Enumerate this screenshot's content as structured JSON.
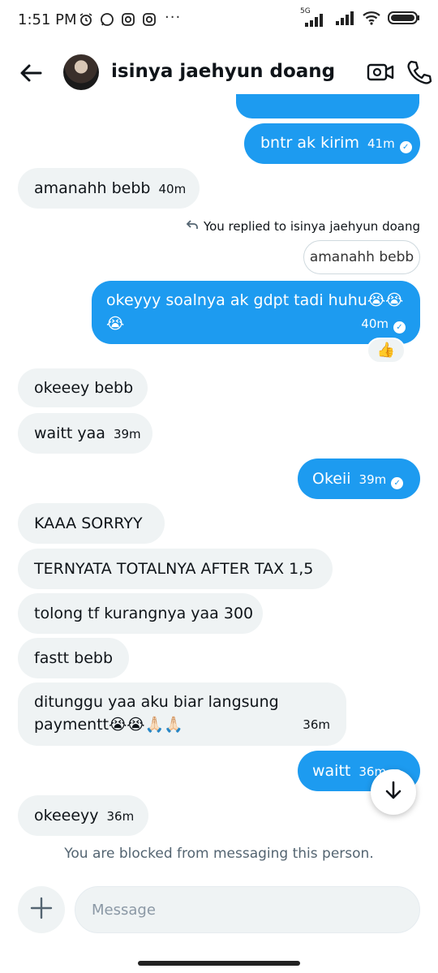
{
  "status_bar": {
    "time": "1:51 PM",
    "left_icons": [
      "alarm-icon",
      "whatsapp-icon",
      "instagram-icon",
      "instagram-icon"
    ],
    "more": "···",
    "network": "5G"
  },
  "header": {
    "title": "isinya jaehyun doang"
  },
  "messages": [
    {
      "dir": "out",
      "text": "bntr ak kirim",
      "time": "41m"
    },
    {
      "dir": "in",
      "text": "amanahh bebb",
      "time": "40m"
    },
    {
      "reply_note": "You replied to isinya jaehyun doang",
      "quoted": "amanahh bebb"
    },
    {
      "dir": "out",
      "text": "okeyyy soalnya ak gdpt tadi huhu😭😭",
      "text2": "😭",
      "time": "40m",
      "reaction": "👍"
    },
    {
      "dir": "in",
      "text": "okeeey bebb"
    },
    {
      "dir": "in",
      "text": "waitt yaa",
      "time": "39m"
    },
    {
      "dir": "out",
      "text": "Okeii",
      "time": "39m"
    },
    {
      "dir": "in",
      "text": "KAAA SORRYY"
    },
    {
      "dir": "in",
      "text": "TERNYATA TOTALNYA AFTER TAX 1,5"
    },
    {
      "dir": "in",
      "text": "tolong tf kurangnya yaa 300"
    },
    {
      "dir": "in",
      "text": "fastt bebb"
    },
    {
      "dir": "in",
      "text": "ditunggu yaa aku biar langsung",
      "text2": "paymentt😭😭🙏🏻🙏🏻",
      "time": "36m"
    },
    {
      "dir": "out",
      "text": "waitt",
      "time": "36m"
    },
    {
      "dir": "in",
      "text": "okeeeyy",
      "time": "36m"
    }
  ],
  "blocked_notice": "You are blocked from messaging this person.",
  "composer": {
    "placeholder": "Message"
  },
  "colors": {
    "accent": "#1d9bf0",
    "incoming_bubble": "#eff3f4",
    "muted_text": "#536471"
  }
}
